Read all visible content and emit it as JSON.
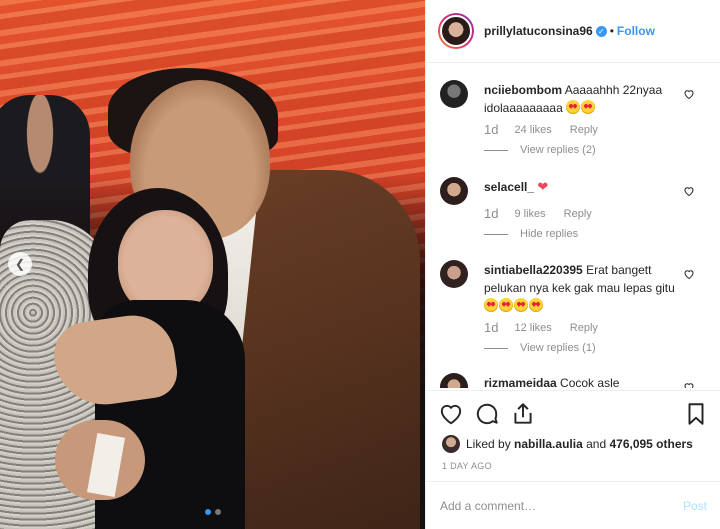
{
  "post": {
    "username": "prillylatuconsina96",
    "verified_mark": "✓",
    "separator": "•",
    "follow_label": "Follow"
  },
  "comments": [
    {
      "user": "nciiebombom",
      "text": "Aaaaahhh 22nyaa idolaaaaaaaaa",
      "emoji": [
        "heart-eyes-emoji",
        "heart-eyes-emoji"
      ],
      "time": "1d",
      "likes": "24 likes",
      "reply_label": "Reply",
      "replies_label": "View replies (2)"
    },
    {
      "user": "selacell_",
      "text": "",
      "heart": "❤",
      "time": "1d",
      "likes": "9 likes",
      "reply_label": "Reply",
      "replies_label": "Hide replies"
    },
    {
      "user": "sintiabella220395",
      "text": "Erat bangett pelukan nya kek gak mau lepas gitu",
      "emoji": [
        "heart-eyes-emoji",
        "heart-eyes-emoji",
        "heart-eyes-emoji",
        "heart-eyes-emoji"
      ],
      "time": "1d",
      "likes": "12 likes",
      "reply_label": "Reply",
      "replies_label": "View replies (1)"
    },
    {
      "user": "rizmameidaa",
      "text": "Cocok asle"
    }
  ],
  "likes": {
    "prefix": "Liked by ",
    "user": "nabilla.aulia",
    "middle": " and ",
    "count": "476,095 others"
  },
  "posted_time": "1 DAY AGO",
  "add_comment": {
    "placeholder": "Add a comment…",
    "post_label": "Post"
  },
  "carousel": {
    "total_slides": 2,
    "active_slide": 1
  },
  "colors": {
    "accent": "#3897f0",
    "heart": "#ed4956",
    "muted": "#8e8e8e"
  },
  "icons": [
    "heart-icon",
    "comment-icon",
    "share-icon",
    "bookmark-icon",
    "chevron-left-icon"
  ]
}
